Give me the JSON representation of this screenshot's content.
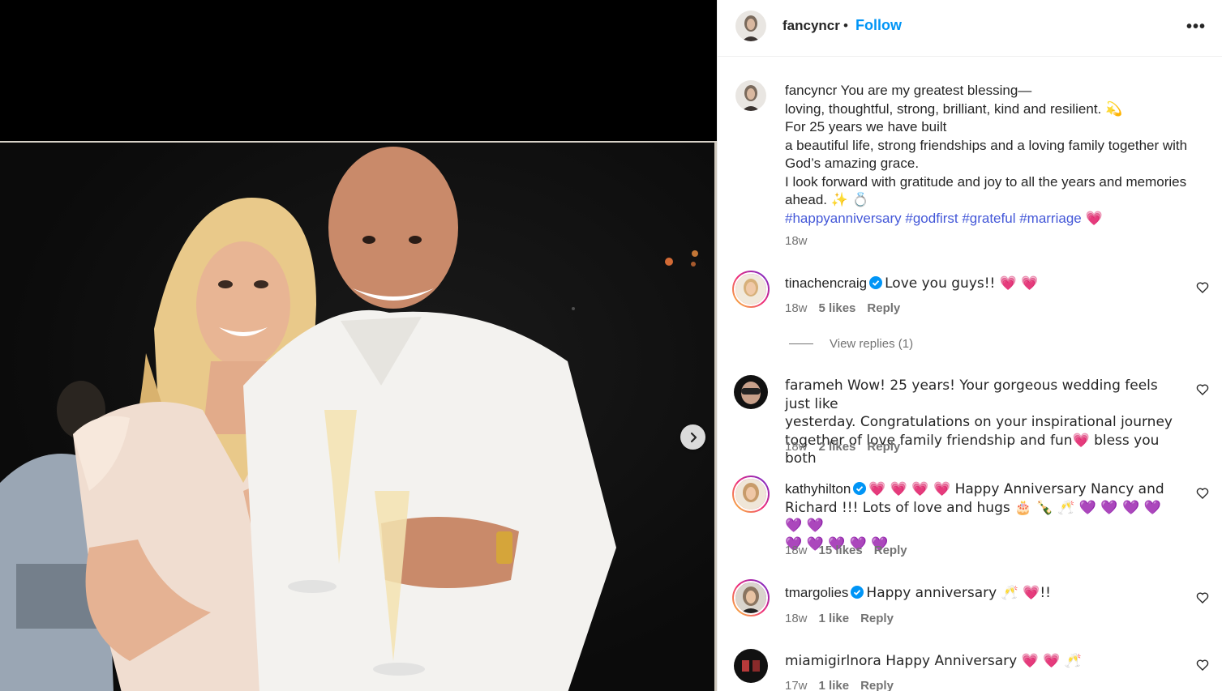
{
  "post": {
    "username": "fancyncr",
    "follow_label": "Follow",
    "dot": "•",
    "more_label": "•••",
    "caption_lines": [
      "fancyncr You are my greatest blessing—",
      "loving, thoughtful, strong, brilliant, kind and resilient. 💫",
      "For 25 years we have built",
      "a beautiful life, strong friendships and a loving family together with",
      "God’s amazing grace.",
      "I look forward with gratitude and joy to all the years and memories",
      "ahead. ✨ 💍"
    ],
    "hashtags": [
      "#happyanniversary",
      "#godfirst",
      "#grateful",
      "#marriage"
    ],
    "hashtag_suffix": "💗",
    "time": "18w"
  },
  "comments": [
    {
      "user": "tinachencraig",
      "verified": true,
      "text": "Love you guys!! 💗 💗",
      "time": "18w",
      "likes": "5 likes",
      "reply": "Reply",
      "view_replies": "View replies (1)"
    },
    {
      "user": "farameh",
      "verified": false,
      "text_lines": [
        "farameh Wow! 25 years! Your gorgeous wedding feels just like",
        "yesterday. Congratulations on your inspirational journey",
        "together of love family friendship and fun💗  bless you both"
      ],
      "time": "18w",
      "likes": "2 likes",
      "reply": "Reply"
    },
    {
      "user": "kathyhilton",
      "verified": true,
      "text_lines": [
        "💗 💗 💗 💗  Happy Anniversary Nancy and",
        "Richard !!! Lots of love and hugs 🎂 🍾 🥂 💜 💜 💜 💜 💜 💜",
        "💜 💜 💜 💜 💜"
      ],
      "time": "18w",
      "likes": "15 likes",
      "reply": "Reply"
    },
    {
      "user": "tmargolies",
      "verified": true,
      "text": "Happy anniversary 🥂 💗!!",
      "time": "18w",
      "likes": "1 like",
      "reply": "Reply"
    },
    {
      "user": "miamigirlnora",
      "verified": false,
      "text": "miamigirlnora Happy Anniversary 💗 💗 🥂",
      "time": "17w",
      "likes": "1 like",
      "reply": "Reply"
    }
  ],
  "icons": {
    "like": "heart-outline-icon",
    "next": "chevron-right-icon",
    "verified": "verified-badge-icon"
  },
  "colors": {
    "follow": "#0095f6",
    "hashtag": "#4458d8",
    "meta": "#737373",
    "verified": "#0095f6"
  }
}
